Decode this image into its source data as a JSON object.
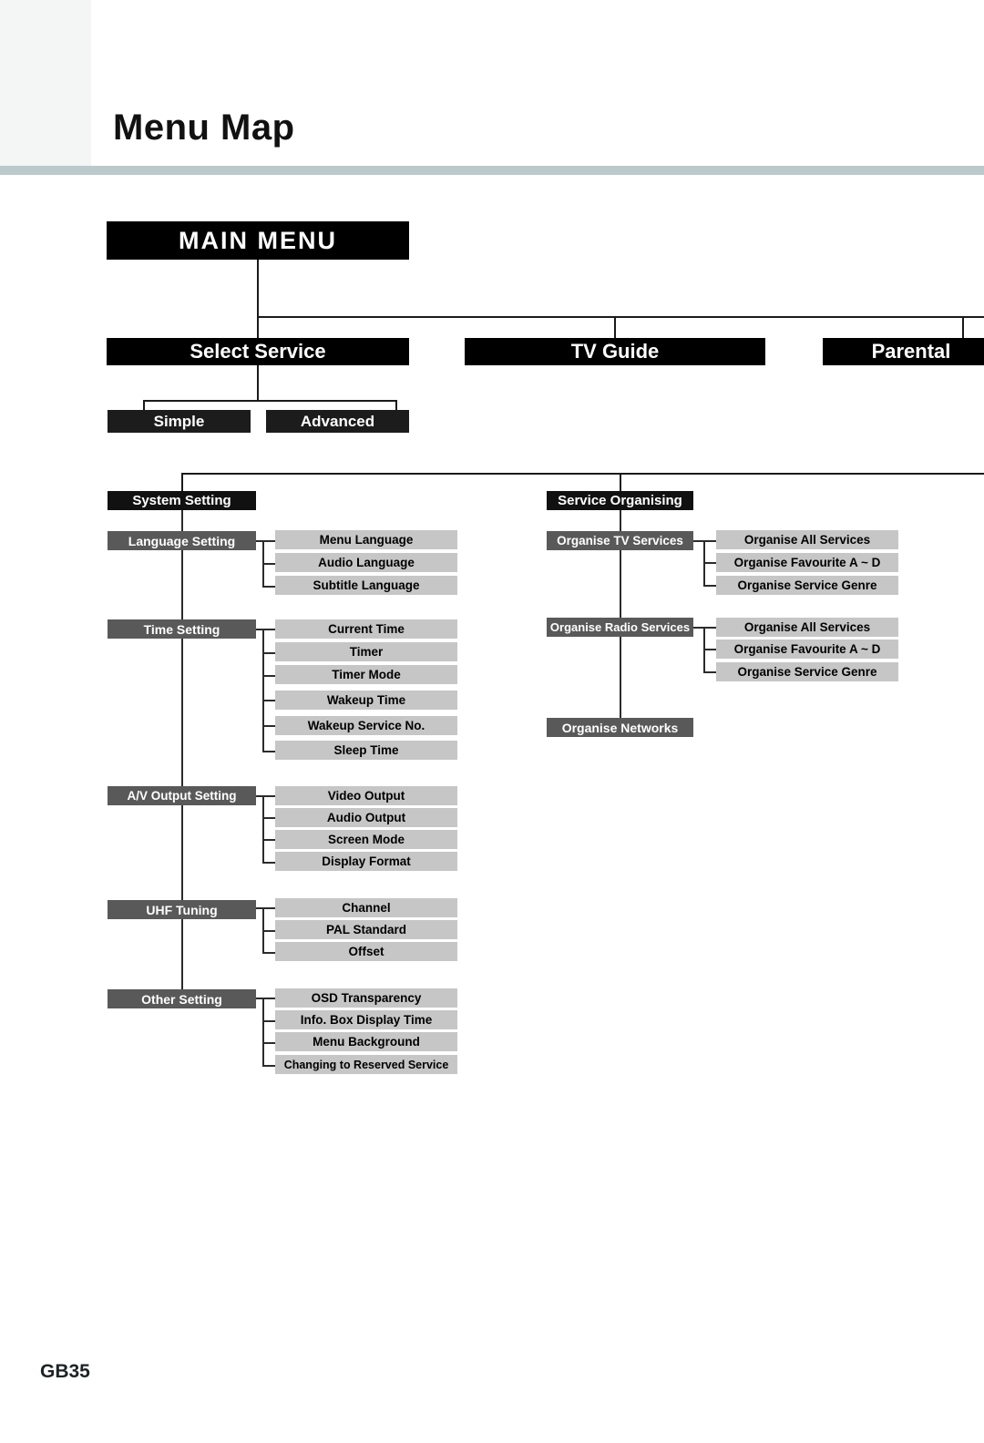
{
  "page": {
    "title": "Menu Map",
    "page_number": "GB35",
    "rule_color": "#bcc9ca",
    "corner_block_color": "#f4f6f5"
  },
  "tree": {
    "root": {
      "label": "MAIN MENU"
    },
    "level1": [
      {
        "label": "Select Service"
      },
      {
        "label": "TV Guide"
      },
      {
        "label": "Parental"
      }
    ],
    "select_service_children": [
      {
        "label": "Simple"
      },
      {
        "label": "Advanced"
      }
    ],
    "categories": [
      {
        "label": "System Setting",
        "groups": [
          {
            "label": "Language Setting",
            "items": [
              {
                "label": "Menu Language"
              },
              {
                "label": "Audio Language"
              },
              {
                "label": "Subtitle Language"
              }
            ]
          },
          {
            "label": "Time Setting",
            "items": [
              {
                "label": "Current Time"
              },
              {
                "label": "Timer"
              },
              {
                "label": "Timer Mode"
              },
              {
                "label": "Wakeup Time"
              },
              {
                "label": "Wakeup Service No."
              },
              {
                "label": "Sleep Time"
              }
            ]
          },
          {
            "label": "A/V Output Setting",
            "items": [
              {
                "label": "Video  Output"
              },
              {
                "label": "Audio Output"
              },
              {
                "label": "Screen Mode"
              },
              {
                "label": "Display Format"
              }
            ]
          },
          {
            "label": "UHF Tuning",
            "items": [
              {
                "label": "Channel"
              },
              {
                "label": "PAL Standard"
              },
              {
                "label": "Offset"
              }
            ]
          },
          {
            "label": "Other Setting",
            "items": [
              {
                "label": "OSD Transparency"
              },
              {
                "label": "Info. Box Display Time"
              },
              {
                "label": "Menu Background"
              },
              {
                "label": "Changing to Reserved Service"
              }
            ]
          }
        ]
      },
      {
        "label": "Service Organising",
        "groups": [
          {
            "label": "Organise TV Services",
            "items": [
              {
                "label": "Organise All Services"
              },
              {
                "label": "Organise Favourite A ~ D"
              },
              {
                "label": "Organise  Service Genre"
              }
            ]
          },
          {
            "label": "Organise Radio Services",
            "items": [
              {
                "label": "Organise All Services"
              },
              {
                "label": "Organise Favourite A ~ D"
              },
              {
                "label": "Organise  Service Genre"
              }
            ]
          },
          {
            "label": "Organise Networks",
            "items": []
          }
        ]
      }
    ]
  }
}
